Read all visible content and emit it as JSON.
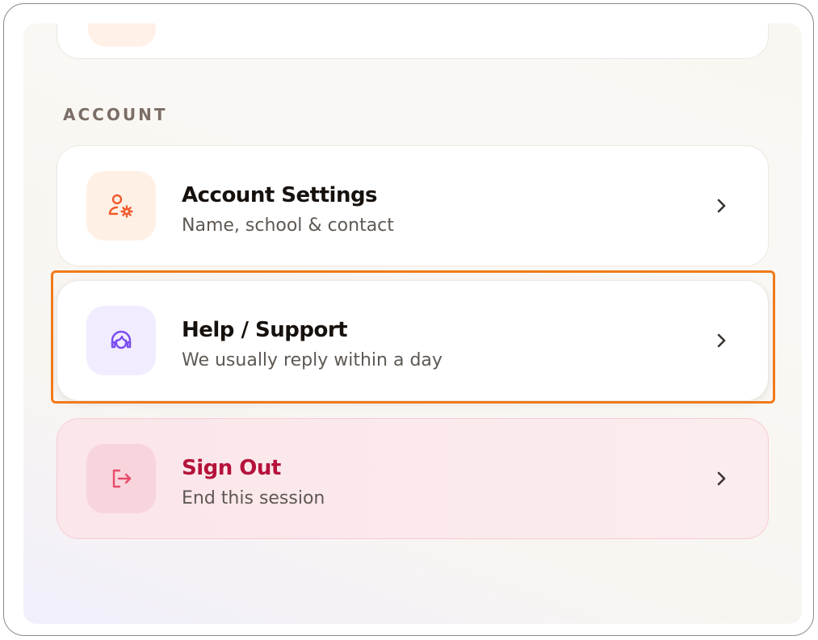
{
  "section": {
    "label": "ACCOUNT"
  },
  "rows": [
    {
      "title": "Account Settings",
      "subtitle": "Name, school & contact",
      "icon": "user-gear-icon",
      "accent": "#ef5a2a"
    },
    {
      "title": "Help / Support",
      "subtitle": "We usually reply within a day",
      "icon": "headset-icon",
      "accent": "#7b4df0"
    },
    {
      "title": "Sign Out",
      "subtitle": "End this session",
      "icon": "logout-icon",
      "accent": "#e84a6a"
    }
  ],
  "colors": {
    "highlight": "#f07a1a",
    "sign_out_title": "#b5123b"
  }
}
